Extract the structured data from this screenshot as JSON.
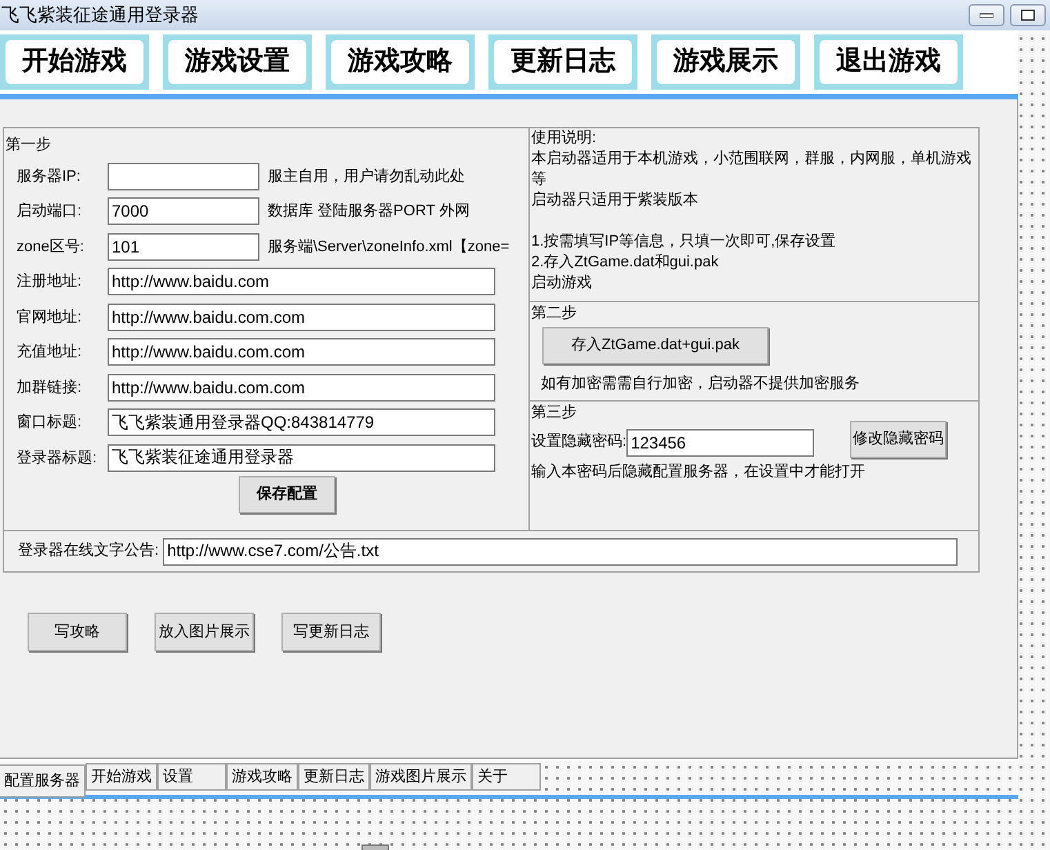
{
  "window": {
    "title": "飞飞紫装征途通用登录器"
  },
  "launcher_buttons": [
    {
      "label": "开始游戏"
    },
    {
      "label": "游戏设置"
    },
    {
      "label": "游戏攻略"
    },
    {
      "label": "更新日志"
    },
    {
      "label": "游戏展示"
    },
    {
      "label": "退出游戏"
    }
  ],
  "step1": {
    "title": "第一步",
    "rows": [
      {
        "kind": "short",
        "label": "服务器IP:",
        "value": "",
        "note": "服主自用，用户请勿乱动此处"
      },
      {
        "kind": "short",
        "label": "启动端口:",
        "value": "7000",
        "note": "数据库 登陆服务器PORT 外网"
      },
      {
        "kind": "short",
        "label": "zone区号:",
        "value": "101",
        "note": "服务端\\Server\\zoneInfo.xml【zone="
      },
      {
        "kind": "long",
        "label": "注册地址:",
        "value": "http://www.baidu.com"
      },
      {
        "kind": "long",
        "label": "官网地址:",
        "value": "http://www.baidu.com.com"
      },
      {
        "kind": "long",
        "label": "充值地址:",
        "value": "http://www.baidu.com.com"
      },
      {
        "kind": "long",
        "label": "加群链接:",
        "value": "http://www.baidu.com.com"
      },
      {
        "kind": "long",
        "label": "窗口标题:",
        "value": "飞飞紫装通用登录器QQ:843814779"
      },
      {
        "kind": "long",
        "label": "登录器标题:",
        "value": "飞飞紫装征途通用登录器"
      }
    ],
    "save_button": "保存配置"
  },
  "instructions": {
    "title": "使用说明:",
    "paragraphs": [
      [
        "本启动器适用于本机游戏，小范围联网，群服，内网服，单机游戏等",
        "启动器只适用于紫装版本"
      ],
      [
        "1.按需填写IP等信息，只填一次即可,保存设置",
        "2.存入ZtGame.dat和gui.pak",
        "启动游戏"
      ]
    ]
  },
  "step2": {
    "title": "第二步",
    "button": "存入ZtGame.dat+gui.pak",
    "note": "如有加密需需自行加密，启动器不提供加密服务"
  },
  "step3": {
    "title": "第三步",
    "label": "设置隐藏密码:",
    "value": "123456",
    "button": "修改隐藏密码",
    "note": "输入本密码后隐藏配置服务器，在设置中才能打开"
  },
  "notice": {
    "label": "登录器在线文字公告:",
    "value": "http://www.cse7.com/公告.txt"
  },
  "action_buttons": [
    "写攻略",
    "放入图片展示",
    "写更新日志"
  ],
  "tabs": [
    {
      "label": "配置服务器",
      "selected": true
    },
    {
      "label": "开始游戏",
      "selected": false
    },
    {
      "label": "设置",
      "selected": false
    },
    {
      "label": "游戏攻略",
      "selected": false
    },
    {
      "label": "更新日志",
      "selected": false
    },
    {
      "label": "游戏图片展示",
      "selected": false
    },
    {
      "label": "关于",
      "selected": false
    }
  ]
}
